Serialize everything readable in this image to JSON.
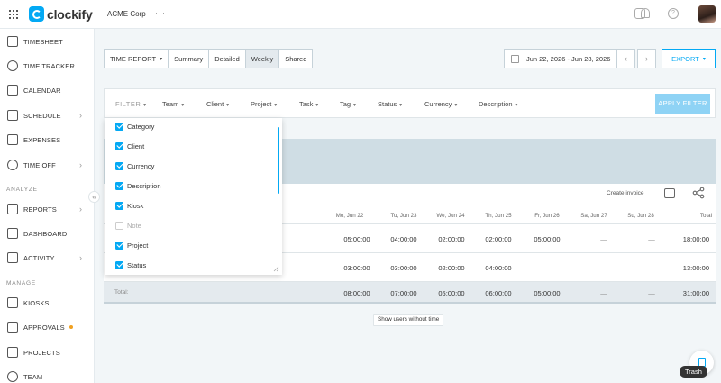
{
  "app": {
    "name": "clockify",
    "workspace": "ACME Corp",
    "workspace_menu": "···"
  },
  "colors": {
    "accent": "#03a9f4",
    "apply_disabled": "#8fd3f5"
  },
  "topbar": {
    "icons": [
      "puzzle-icon",
      "bell-icon",
      "help-icon"
    ],
    "help_glyph": "?"
  },
  "sidebar": {
    "items": [
      {
        "label": "TIMESHEET",
        "icon": "timesheet-icon"
      },
      {
        "label": "TIME TRACKER",
        "icon": "clock-icon"
      },
      {
        "label": "CALENDAR",
        "icon": "calendar-icon"
      },
      {
        "label": "SCHEDULE",
        "icon": "schedule-icon",
        "chevron": "›"
      },
      {
        "label": "EXPENSES",
        "icon": "expenses-icon"
      },
      {
        "label": "TIME OFF",
        "icon": "time-off-icon",
        "chevron": "›"
      }
    ],
    "analyze_label": "ANALYZE",
    "analyze_items": [
      {
        "label": "REPORTS",
        "icon": "reports-icon",
        "chevron": "›"
      },
      {
        "label": "DASHBOARD",
        "icon": "dashboard-icon"
      },
      {
        "label": "ACTIVITY",
        "icon": "activity-icon",
        "chevron": "›"
      }
    ],
    "manage_label": "MANAGE",
    "manage_items": [
      {
        "label": "KIOSKS",
        "icon": "kiosk-icon"
      },
      {
        "label": "APPROVALS",
        "icon": "approvals-icon"
      },
      {
        "label": "PROJECTS",
        "icon": "projects-icon"
      },
      {
        "label": "TEAM",
        "icon": "team-icon"
      }
    ],
    "collapse": "«"
  },
  "report_tabs": {
    "type_label": "TIME REPORT",
    "caret": "▾",
    "tabs": [
      "Summary",
      "Detailed",
      "Weekly",
      "Shared"
    ],
    "active": "Weekly"
  },
  "date_range": "Jun 22, 2026 - Jun 28, 2026",
  "nav": {
    "prev": "‹",
    "next": "›"
  },
  "export_label": "EXPORT",
  "filters": {
    "title": "FILTER",
    "caret": "▾",
    "items": [
      "Team",
      "Client",
      "Project",
      "Task",
      "Tag",
      "Status",
      "Currency",
      "Description"
    ],
    "apply_label": "APPLY FILTER"
  },
  "filter_dropdown": {
    "options": [
      {
        "label": "Category",
        "checked": true
      },
      {
        "label": "Client",
        "checked": true
      },
      {
        "label": "Currency",
        "checked": true
      },
      {
        "label": "Description",
        "checked": true
      },
      {
        "label": "Kiosk",
        "checked": true
      },
      {
        "label": "Note",
        "checked": false
      },
      {
        "label": "Project",
        "checked": true
      },
      {
        "label": "Status",
        "checked": true
      }
    ]
  },
  "report": {
    "create_invoice": "Create invoice",
    "columns": [
      "Mo, Jun 22",
      "Tu, Jun 23",
      "We, Jun 24",
      "Th, Jun 25",
      "Fr, Jun 26",
      "Sa, Jun 27",
      "Su, Jun 28"
    ],
    "total_header": "Total",
    "rows": [
      {
        "values": [
          "05:00:00",
          "04:00:00",
          "02:00:00",
          "02:00:00",
          "05:00:00",
          "—",
          "—"
        ],
        "total": "18:00:00"
      },
      {
        "values": [
          "03:00:00",
          "03:00:00",
          "02:00:00",
          "04:00:00",
          "—",
          "—",
          "—"
        ],
        "total": "13:00:00"
      }
    ],
    "total_row": {
      "label": "Total:",
      "values": [
        "08:00:00",
        "07:00:00",
        "05:00:00",
        "06:00:00",
        "05:00:00",
        "—",
        "—"
      ],
      "total": "31:00:00"
    },
    "show_users_label": "Show users without time"
  },
  "trash": {
    "tooltip": "Trash"
  }
}
